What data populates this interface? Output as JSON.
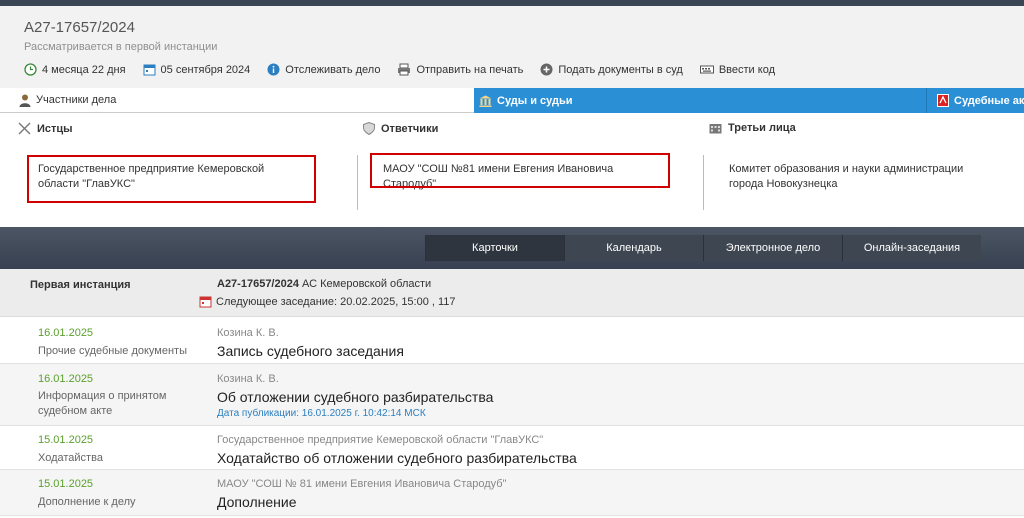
{
  "case": {
    "number": "А27-17657/2024",
    "status": "Рассматривается в первой инстанции",
    "actions": [
      {
        "label": "4 месяца 22 дня",
        "icon": "clock-icon"
      },
      {
        "label": "05 сентября 2024",
        "icon": "calendar-icon"
      },
      {
        "label": "Отслеживать дело",
        "icon": "track-icon"
      },
      {
        "label": "Отправить на печать",
        "icon": "printer-icon"
      },
      {
        "label": "Подать документы в суд",
        "icon": "submit-icon"
      },
      {
        "label": "Ввести код",
        "icon": "keyboard-icon"
      }
    ]
  },
  "tabs": {
    "participants": "Участники дела",
    "courts": "Суды и судьи",
    "acts": "Судебные акты"
  },
  "parties": {
    "plaintiffs_label": "Истцы",
    "plaintiff": "Государственное предприятие Кемеровской области \"ГлавУКС\"",
    "defendants_label": "Ответчики",
    "defendant": "МАОУ \"СОШ №81 имени Евгения Ивановича Стародуб\"",
    "third_label": "Третьи лица",
    "third": "Комитет образования и науки администрации города Новокузнецка"
  },
  "nav": {
    "cards": "Карточки",
    "calendar": "Календарь",
    "ecase": "Электронное дело",
    "online": "Онлайн-заседания"
  },
  "first_instance": {
    "label": "Первая инстанция",
    "case_number": "А27-17657/2024",
    "court": "АС Кемеровской области",
    "next_session": "Следующее заседание: 20.02.2025, 15:00 , 117"
  },
  "entries": [
    {
      "date": "16.01.2025",
      "type": "Прочие судебные документы",
      "author": "Козина К. В.",
      "title": "Запись судебного заседания",
      "published": ""
    },
    {
      "date": "16.01.2025",
      "type": "Информация о принятом судебном акте",
      "author": "Козина К. В.",
      "title": "Об отложении судебного разбирательства",
      "published": "Дата публикации: 16.01.2025 г. 10:42:14 МСК"
    },
    {
      "date": "15.01.2025",
      "type": "Ходатайства",
      "author": "Государственное предприятие Кемеровской области \"ГлавУКС\"",
      "title": "Ходатайство об отложении судебного разбирательства",
      "published": ""
    },
    {
      "date": "15.01.2025",
      "type": "Дополнение к делу",
      "author": "МАОУ \"СОШ № 81 имени Евгения Ивановича Стародуб\"",
      "title": "Дополнение",
      "published": ""
    }
  ]
}
